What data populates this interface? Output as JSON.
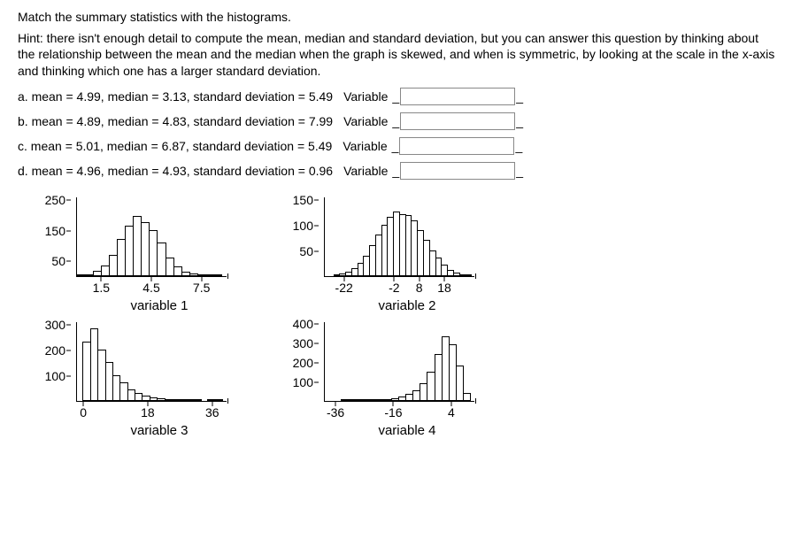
{
  "title": "Match the summary statistics with the histograms.",
  "hint": "Hint: there isn't enough detail to compute the mean, median and standard deviation, but you can answer this question by thinking about the relationship between the mean and the median when the graph is skewed, and when is symmetric, by looking at the scale in the x-axis and thinking which one has a larger standard deviation.",
  "stats": {
    "a": "a. mean = 4.99, median = 3.13, standard deviation = 5.49",
    "b": "b. mean = 4.89, median = 4.83, standard deviation = 7.99",
    "c": "c. mean = 5.01, median = 6.87, standard deviation = 5.49",
    "d": "d. mean = 4.96, median = 4.93, standard deviation = 0.96"
  },
  "variable_label": "Variable",
  "underscore": "_",
  "chart_data": [
    {
      "type": "bar",
      "label": "variable 1",
      "y_ticks": [
        50,
        150,
        250
      ],
      "x_ticks": [
        1.5,
        4.5,
        7.5
      ],
      "x_range": [
        0,
        9
      ],
      "y_max": 260,
      "values": [
        3,
        6,
        18,
        35,
        70,
        120,
        165,
        195,
        175,
        150,
        110,
        60,
        32,
        15,
        8,
        4,
        2,
        1
      ],
      "pad_left": 0
    },
    {
      "type": "bar",
      "label": "variable 2",
      "y_ticks": [
        50,
        100,
        150
      ],
      "x_ticks": [
        -22,
        -2,
        8,
        18
      ],
      "x_range": [
        -30,
        30
      ],
      "y_max": 155,
      "values": [
        2,
        4,
        8,
        15,
        25,
        40,
        60,
        80,
        100,
        115,
        125,
        120,
        118,
        108,
        90,
        70,
        50,
        35,
        22,
        12,
        6,
        3,
        1
      ],
      "pad_left": 2
    },
    {
      "type": "bar",
      "label": "variable 3",
      "y_ticks": [
        100,
        200,
        300
      ],
      "x_ticks": [
        0.0,
        18.0,
        36.0
      ],
      "x_range": [
        -2,
        40
      ],
      "y_max": 310,
      "values": [
        230,
        280,
        200,
        150,
        100,
        70,
        45,
        30,
        20,
        14,
        9,
        6,
        4,
        2,
        2,
        1,
        0,
        1,
        1
      ],
      "pad_left": 1
    },
    {
      "type": "bar",
      "label": "variable 4",
      "y_ticks": [
        100,
        200,
        300,
        400
      ],
      "x_ticks": [
        -36,
        -16,
        4
      ],
      "x_range": [
        -40,
        12
      ],
      "y_max": 410,
      "values": [
        1,
        1,
        2,
        3,
        4,
        6,
        9,
        14,
        22,
        35,
        55,
        90,
        150,
        240,
        330,
        290,
        180,
        40
      ],
      "pad_left": 3
    }
  ]
}
